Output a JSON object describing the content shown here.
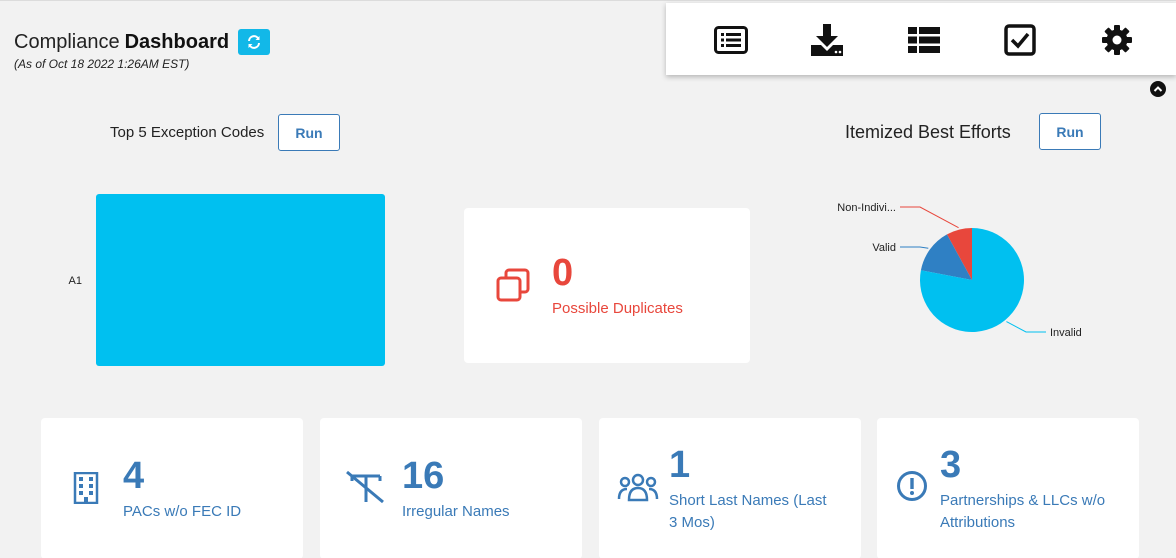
{
  "header": {
    "title_prefix": "Compliance",
    "title_strong": "Dashboard",
    "as_of": "(As of Oct 18 2022 1:26AM EST)"
  },
  "toolbar": {
    "icons": [
      "list-icon",
      "download-icon",
      "table-icon",
      "checkbox-icon",
      "gear-icon"
    ]
  },
  "exceptions": {
    "title": "Top 5 Exception Codes",
    "run_label": "Run"
  },
  "itemized": {
    "title": "Itemized Best Efforts",
    "run_label": "Run"
  },
  "duplicates": {
    "count": "0",
    "label": "Possible Duplicates",
    "color": "#e8473c"
  },
  "stats": [
    {
      "count": "4",
      "label": "PACs w/o FEC ID",
      "icon": "building-icon"
    },
    {
      "count": "16",
      "label": "Irregular Names",
      "icon": "strikethrough-text-icon"
    },
    {
      "count": "1",
      "label": "Short Last Names (Last",
      "label2": "3 Mos)",
      "icon": "users-icon"
    },
    {
      "count": "3",
      "label": "Partnerships & LLCs w/o",
      "label2": "Attributions",
      "icon": "exclamation-circle-icon"
    }
  ],
  "colors": {
    "accent_blue": "#3a7ab7",
    "cyan": "#00c0f0",
    "red": "#e8473c",
    "pie_blue": "#2f80c4"
  },
  "chart_data": [
    {
      "type": "bar",
      "categories": [
        "A1"
      ],
      "values": [
        1
      ],
      "title": "Top 5 Exception Codes"
    },
    {
      "type": "pie",
      "title": "Itemized Best Efforts",
      "labels": [
        "Non-Indivi...",
        "Valid",
        "Invalid"
      ],
      "values": [
        8,
        14,
        78
      ],
      "colors": [
        "#e8473c",
        "#2f80c4",
        "#00c0f0"
      ]
    }
  ]
}
